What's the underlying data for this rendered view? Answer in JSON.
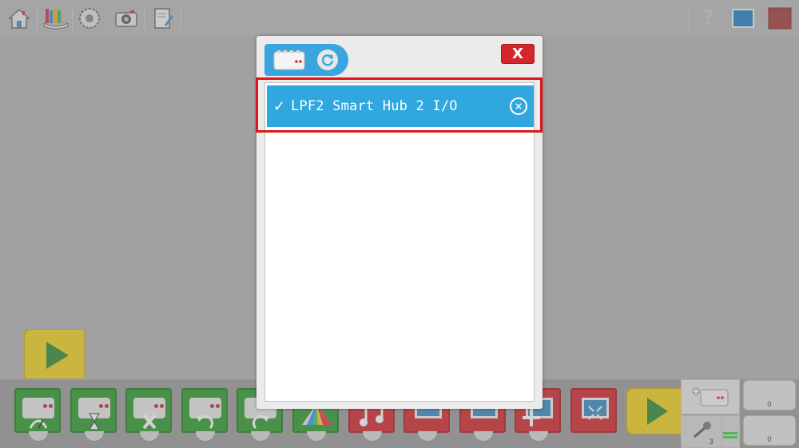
{
  "toolbar": {
    "left_icons": [
      "home-icon",
      "library-icon",
      "settings-gear-icon",
      "camera-icon",
      "document-edit-icon"
    ],
    "right_icons": [
      "help-icon",
      "display-icon",
      "stop-icon"
    ]
  },
  "dialog": {
    "tab_icons": [
      "hub-icon",
      "refresh-icon"
    ],
    "close_label": "X",
    "hub_list": [
      {
        "check": "✓",
        "name": "LPF2 Smart Hub 2 I/O",
        "connected": true
      }
    ],
    "disconnect_label": "×"
  },
  "palette": {
    "blocks": [
      {
        "color": "green",
        "icon": "motor-power-icon"
      },
      {
        "color": "green",
        "icon": "motor-time-icon"
      },
      {
        "color": "green",
        "icon": "motor-stop-icon"
      },
      {
        "color": "green",
        "icon": "motor-direction-ccw-icon"
      },
      {
        "color": "green",
        "icon": "motor-direction-cw-icon"
      },
      {
        "color": "green",
        "icon": "light-color-icon"
      },
      {
        "color": "red",
        "icon": "sound-icon"
      },
      {
        "color": "red",
        "icon": "display-background-icon"
      },
      {
        "color": "red",
        "icon": "display-image-icon"
      },
      {
        "color": "red",
        "icon": "display-add-icon"
      },
      {
        "color": "red",
        "icon": "display-fullscreen-icon"
      }
    ]
  },
  "right_panel": {
    "mic_value": "3",
    "counter_top": "0",
    "counter_bottom": "0"
  },
  "colors": {
    "accent_blue": "#30a7df",
    "block_green": "#2c9a2c",
    "block_red": "#d3252c",
    "start_yellow": "#f2d21b",
    "highlight_red": "#e0141b"
  }
}
